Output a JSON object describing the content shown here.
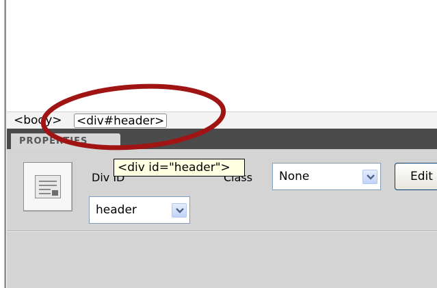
{
  "tag_selector": {
    "body_tag": "<body>",
    "div_tag": "<div#header>"
  },
  "properties_panel": {
    "tab_label": "PROPERTIES",
    "div_id_label": "Div ID",
    "div_id_value": "header",
    "class_label": "Class",
    "class_value": "None",
    "edit_button_label": "Edit"
  },
  "tooltip": {
    "text": "<div id=\"header\">"
  },
  "colors": {
    "annotation_ellipse": "#a01414",
    "panel_header": "#4b4b4b",
    "panel_body": "#d4d4d4",
    "tooltip_bg": "#ffffe1"
  }
}
